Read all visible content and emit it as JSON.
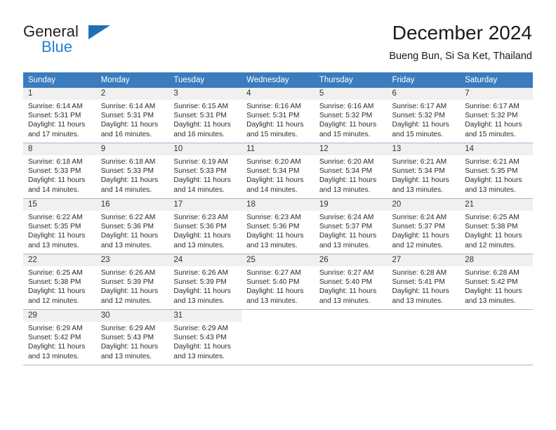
{
  "brand": {
    "name_part1": "General",
    "name_part2": "Blue",
    "logo_icon": "triangle-logo-icon"
  },
  "header": {
    "month_title": "December 2024",
    "location": "Bueng Bun, Si Sa Ket, Thailand"
  },
  "colors": {
    "header_row": "#3a7cbe",
    "brand_blue": "#1f7fd1",
    "daynum_background": "#f0f0f0",
    "grid_line": "#9fb9d4"
  },
  "calendar": {
    "weekday_headers": [
      "Sunday",
      "Monday",
      "Tuesday",
      "Wednesday",
      "Thursday",
      "Friday",
      "Saturday"
    ],
    "weeks": [
      [
        {
          "day": "1",
          "sunrise": "Sunrise: 6:14 AM",
          "sunset": "Sunset: 5:31 PM",
          "daylight1": "Daylight: 11 hours",
          "daylight2": "and 17 minutes."
        },
        {
          "day": "2",
          "sunrise": "Sunrise: 6:14 AM",
          "sunset": "Sunset: 5:31 PM",
          "daylight1": "Daylight: 11 hours",
          "daylight2": "and 16 minutes."
        },
        {
          "day": "3",
          "sunrise": "Sunrise: 6:15 AM",
          "sunset": "Sunset: 5:31 PM",
          "daylight1": "Daylight: 11 hours",
          "daylight2": "and 16 minutes."
        },
        {
          "day": "4",
          "sunrise": "Sunrise: 6:16 AM",
          "sunset": "Sunset: 5:31 PM",
          "daylight1": "Daylight: 11 hours",
          "daylight2": "and 15 minutes."
        },
        {
          "day": "5",
          "sunrise": "Sunrise: 6:16 AM",
          "sunset": "Sunset: 5:32 PM",
          "daylight1": "Daylight: 11 hours",
          "daylight2": "and 15 minutes."
        },
        {
          "day": "6",
          "sunrise": "Sunrise: 6:17 AM",
          "sunset": "Sunset: 5:32 PM",
          "daylight1": "Daylight: 11 hours",
          "daylight2": "and 15 minutes."
        },
        {
          "day": "7",
          "sunrise": "Sunrise: 6:17 AM",
          "sunset": "Sunset: 5:32 PM",
          "daylight1": "Daylight: 11 hours",
          "daylight2": "and 15 minutes."
        }
      ],
      [
        {
          "day": "8",
          "sunrise": "Sunrise: 6:18 AM",
          "sunset": "Sunset: 5:33 PM",
          "daylight1": "Daylight: 11 hours",
          "daylight2": "and 14 minutes."
        },
        {
          "day": "9",
          "sunrise": "Sunrise: 6:18 AM",
          "sunset": "Sunset: 5:33 PM",
          "daylight1": "Daylight: 11 hours",
          "daylight2": "and 14 minutes."
        },
        {
          "day": "10",
          "sunrise": "Sunrise: 6:19 AM",
          "sunset": "Sunset: 5:33 PM",
          "daylight1": "Daylight: 11 hours",
          "daylight2": "and 14 minutes."
        },
        {
          "day": "11",
          "sunrise": "Sunrise: 6:20 AM",
          "sunset": "Sunset: 5:34 PM",
          "daylight1": "Daylight: 11 hours",
          "daylight2": "and 14 minutes."
        },
        {
          "day": "12",
          "sunrise": "Sunrise: 6:20 AM",
          "sunset": "Sunset: 5:34 PM",
          "daylight1": "Daylight: 11 hours",
          "daylight2": "and 13 minutes."
        },
        {
          "day": "13",
          "sunrise": "Sunrise: 6:21 AM",
          "sunset": "Sunset: 5:34 PM",
          "daylight1": "Daylight: 11 hours",
          "daylight2": "and 13 minutes."
        },
        {
          "day": "14",
          "sunrise": "Sunrise: 6:21 AM",
          "sunset": "Sunset: 5:35 PM",
          "daylight1": "Daylight: 11 hours",
          "daylight2": "and 13 minutes."
        }
      ],
      [
        {
          "day": "15",
          "sunrise": "Sunrise: 6:22 AM",
          "sunset": "Sunset: 5:35 PM",
          "daylight1": "Daylight: 11 hours",
          "daylight2": "and 13 minutes."
        },
        {
          "day": "16",
          "sunrise": "Sunrise: 6:22 AM",
          "sunset": "Sunset: 5:36 PM",
          "daylight1": "Daylight: 11 hours",
          "daylight2": "and 13 minutes."
        },
        {
          "day": "17",
          "sunrise": "Sunrise: 6:23 AM",
          "sunset": "Sunset: 5:36 PM",
          "daylight1": "Daylight: 11 hours",
          "daylight2": "and 13 minutes."
        },
        {
          "day": "18",
          "sunrise": "Sunrise: 6:23 AM",
          "sunset": "Sunset: 5:36 PM",
          "daylight1": "Daylight: 11 hours",
          "daylight2": "and 13 minutes."
        },
        {
          "day": "19",
          "sunrise": "Sunrise: 6:24 AM",
          "sunset": "Sunset: 5:37 PM",
          "daylight1": "Daylight: 11 hours",
          "daylight2": "and 13 minutes."
        },
        {
          "day": "20",
          "sunrise": "Sunrise: 6:24 AM",
          "sunset": "Sunset: 5:37 PM",
          "daylight1": "Daylight: 11 hours",
          "daylight2": "and 12 minutes."
        },
        {
          "day": "21",
          "sunrise": "Sunrise: 6:25 AM",
          "sunset": "Sunset: 5:38 PM",
          "daylight1": "Daylight: 11 hours",
          "daylight2": "and 12 minutes."
        }
      ],
      [
        {
          "day": "22",
          "sunrise": "Sunrise: 6:25 AM",
          "sunset": "Sunset: 5:38 PM",
          "daylight1": "Daylight: 11 hours",
          "daylight2": "and 12 minutes."
        },
        {
          "day": "23",
          "sunrise": "Sunrise: 6:26 AM",
          "sunset": "Sunset: 5:39 PM",
          "daylight1": "Daylight: 11 hours",
          "daylight2": "and 12 minutes."
        },
        {
          "day": "24",
          "sunrise": "Sunrise: 6:26 AM",
          "sunset": "Sunset: 5:39 PM",
          "daylight1": "Daylight: 11 hours",
          "daylight2": "and 13 minutes."
        },
        {
          "day": "25",
          "sunrise": "Sunrise: 6:27 AM",
          "sunset": "Sunset: 5:40 PM",
          "daylight1": "Daylight: 11 hours",
          "daylight2": "and 13 minutes."
        },
        {
          "day": "26",
          "sunrise": "Sunrise: 6:27 AM",
          "sunset": "Sunset: 5:40 PM",
          "daylight1": "Daylight: 11 hours",
          "daylight2": "and 13 minutes."
        },
        {
          "day": "27",
          "sunrise": "Sunrise: 6:28 AM",
          "sunset": "Sunset: 5:41 PM",
          "daylight1": "Daylight: 11 hours",
          "daylight2": "and 13 minutes."
        },
        {
          "day": "28",
          "sunrise": "Sunrise: 6:28 AM",
          "sunset": "Sunset: 5:42 PM",
          "daylight1": "Daylight: 11 hours",
          "daylight2": "and 13 minutes."
        }
      ],
      [
        {
          "day": "29",
          "sunrise": "Sunrise: 6:29 AM",
          "sunset": "Sunset: 5:42 PM",
          "daylight1": "Daylight: 11 hours",
          "daylight2": "and 13 minutes."
        },
        {
          "day": "30",
          "sunrise": "Sunrise: 6:29 AM",
          "sunset": "Sunset: 5:43 PM",
          "daylight1": "Daylight: 11 hours",
          "daylight2": "and 13 minutes."
        },
        {
          "day": "31",
          "sunrise": "Sunrise: 6:29 AM",
          "sunset": "Sunset: 5:43 PM",
          "daylight1": "Daylight: 11 hours",
          "daylight2": "and 13 minutes."
        },
        {
          "day": "",
          "sunrise": "",
          "sunset": "",
          "daylight1": "",
          "daylight2": ""
        },
        {
          "day": "",
          "sunrise": "",
          "sunset": "",
          "daylight1": "",
          "daylight2": ""
        },
        {
          "day": "",
          "sunrise": "",
          "sunset": "",
          "daylight1": "",
          "daylight2": ""
        },
        {
          "day": "",
          "sunrise": "",
          "sunset": "",
          "daylight1": "",
          "daylight2": ""
        }
      ]
    ]
  }
}
